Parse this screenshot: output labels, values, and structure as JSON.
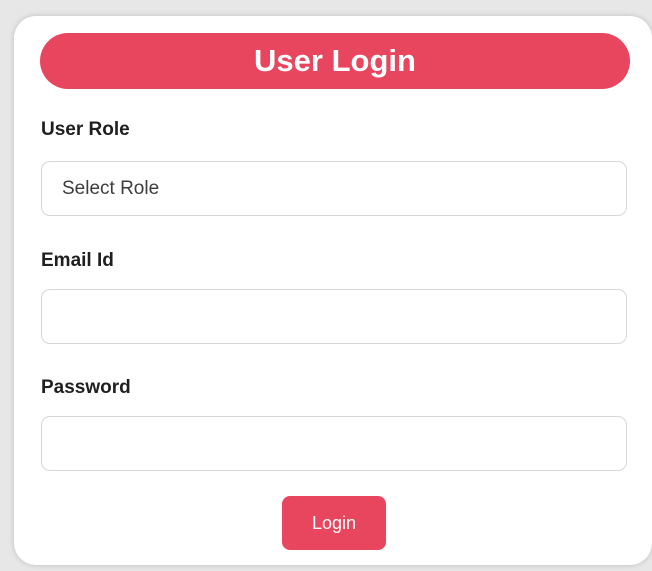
{
  "login_form": {
    "title": "User Login",
    "user_role": {
      "label": "User Role",
      "selected_value": "Select Role"
    },
    "email": {
      "label": "Email Id",
      "value": ""
    },
    "password": {
      "label": "Password",
      "value": ""
    },
    "login_button": "Login"
  },
  "colors": {
    "accent": "#e8465f",
    "background": "#ffffff",
    "input_border": "#d7d7d7"
  }
}
